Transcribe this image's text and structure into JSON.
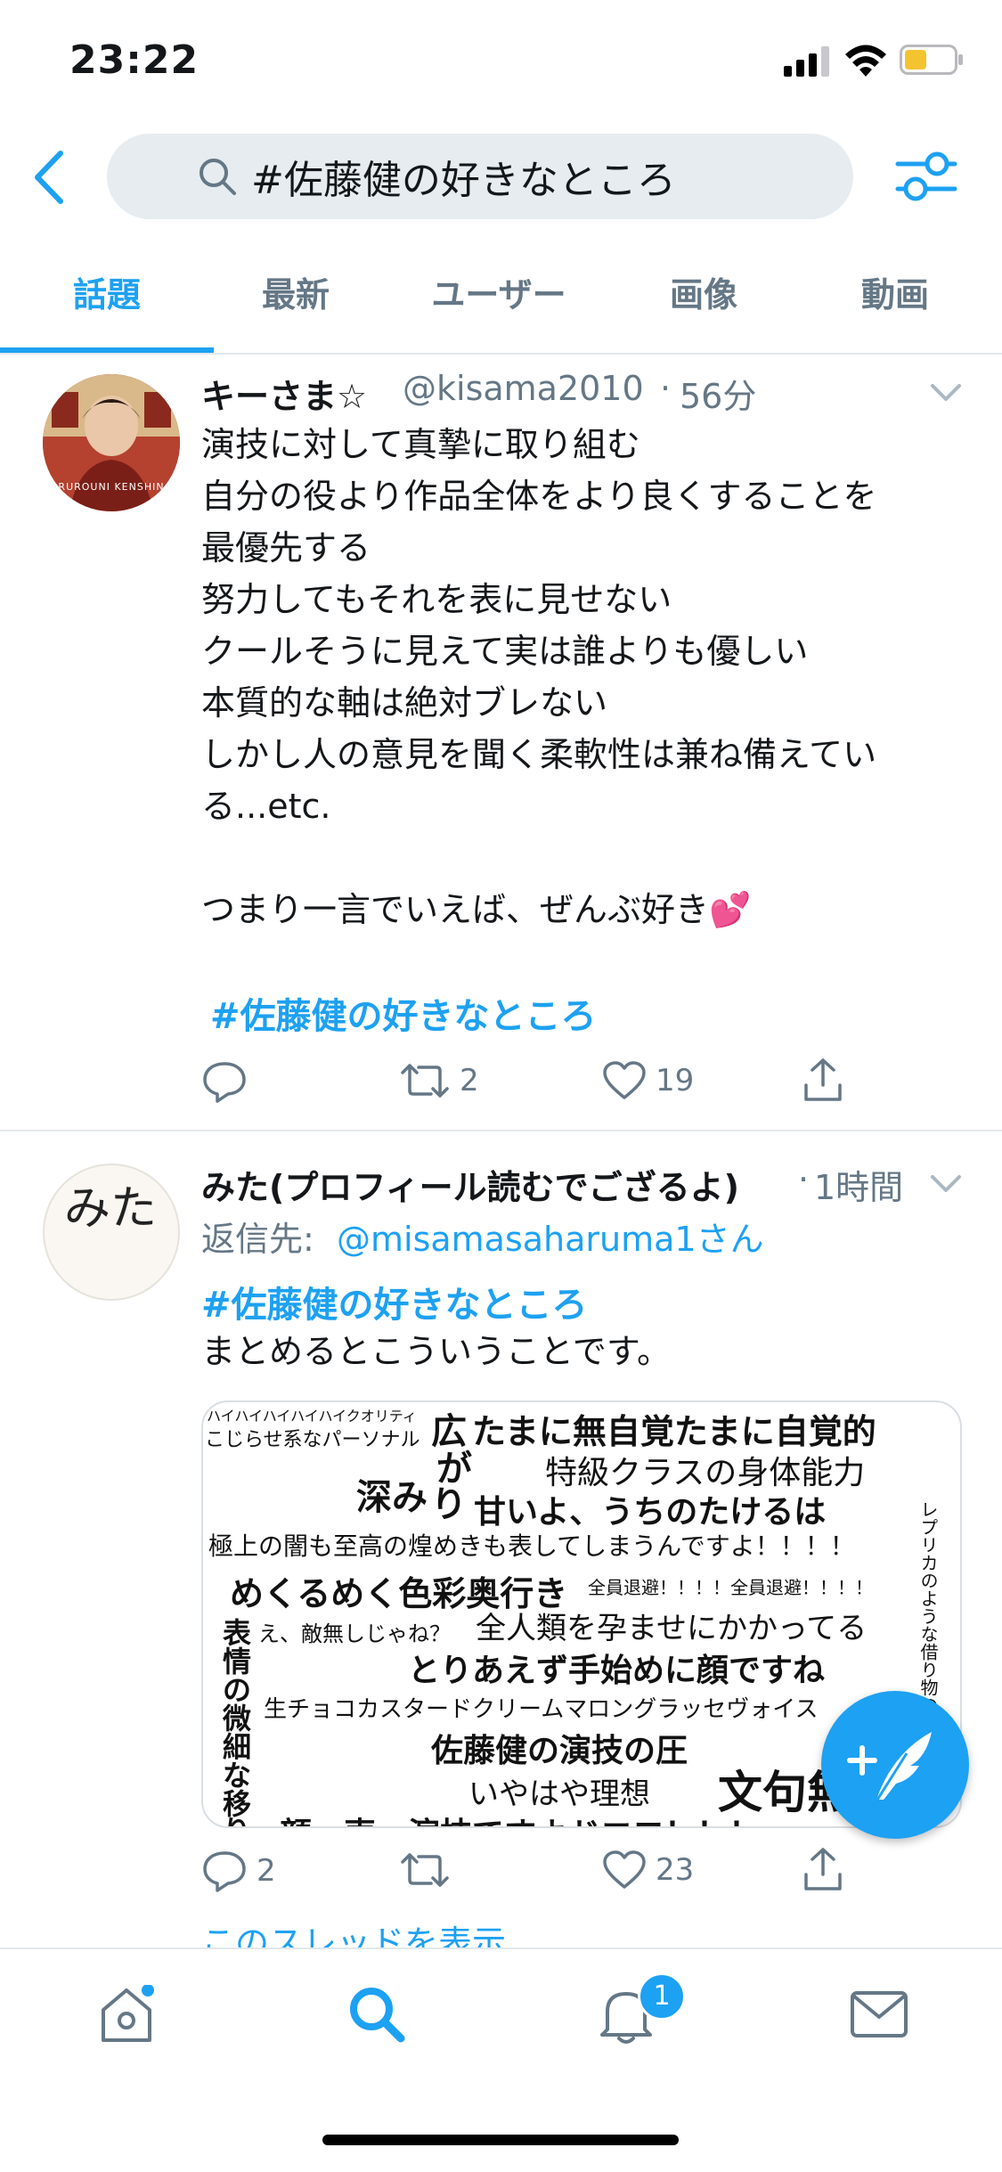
{
  "status_bar": {
    "time": "23:22"
  },
  "search": {
    "query": "#佐藤健の好きなところ"
  },
  "tabs": [
    {
      "label": "話題",
      "active": true
    },
    {
      "label": "最新"
    },
    {
      "label": "ユーザー"
    },
    {
      "label": "画像"
    },
    {
      "label": "動画"
    }
  ],
  "tweet1": {
    "name": "キーさま☆",
    "handle": "@kisama2010",
    "sep": "·",
    "time": "56分",
    "avatar_caption": "RUROUNI KENSHIN",
    "text": "演技に対して真摯に取り組む\n自分の役より作品全体をより良くすることを\n最優先する\n努力してもそれを表に見せない\nクールそうに見えて実は誰よりも優しい\n本質的な軸は絶対ブレない\nしかし人の意見を聞く柔軟性は兼ね備えてい\nる...etc.\n\nつまり一言でいえば、ぜんぶ好き💕",
    "hashtag": "#佐藤健の好きなところ",
    "retweets": "2",
    "likes": "19"
  },
  "tweet2": {
    "name": "みた(プロフィール読むでござるよ)",
    "sep": "·",
    "time": "1時間",
    "avatar_text": "みた",
    "reply_label": "返信先: ",
    "reply_to": "@misamasaharuma1さん",
    "hashtag": "#佐藤健の好きなところ",
    "text": "まとめるとこういうことです。",
    "replies": "2",
    "likes": "23",
    "show_thread": "このスレッドを表示",
    "collage": [
      "ハイハイハイハイハイクオリティ",
      "こじらせ系なパーソナル",
      "広",
      "が",
      "たまに無自覚たまに自覚的",
      "特級クラスの身体能力",
      "深み",
      "り",
      "甘いよ、うちのたけるは",
      "極上の闇も至高の煌めきも表してしまうんですよ！！！！",
      "めくるめく色彩奥行き",
      "全員退避！！！！全員退避！！！！",
      "表",
      "え、敵無しじゃね？",
      "全人類を孕ませにかかってる",
      "情",
      "の",
      "とりあえず手始めに顔ですね",
      "微",
      "生チョコカスタードクリームマロングラッセヴォイス",
      "細",
      "佐藤健の演技の圧",
      "な",
      "いやはや理想",
      "文句無し",
      "移",
      "り",
      "顔・声・演技ですよドエロ！！！",
      "レプリカのような借り物のようで"
    ]
  },
  "bottom_nav": {
    "notification_count": "1"
  },
  "colors": {
    "accent": "#1da1f2",
    "muted": "#657786",
    "border": "#e1e8ed"
  }
}
